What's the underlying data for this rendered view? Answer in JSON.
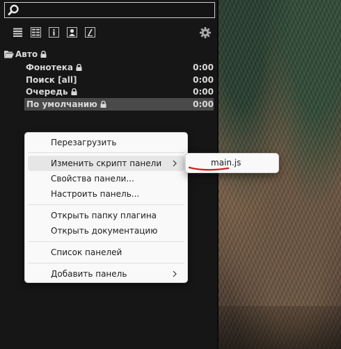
{
  "search": {
    "value": "",
    "placeholder": ""
  },
  "toolbar": {
    "buttons": [
      "list-view-icon",
      "grid-view-icon",
      "info-icon",
      "person-icon",
      "edit-icon"
    ],
    "settings_icon": "gear-icon"
  },
  "tree": {
    "root": {
      "label": "Авто",
      "icon": "folder-open-icon",
      "locked": true
    },
    "items": [
      {
        "label": "Фонотека",
        "time": "0:00",
        "locked": true,
        "selected": false
      },
      {
        "label": "Поиск [all]",
        "time": "0:00",
        "locked": false,
        "selected": false
      },
      {
        "label": "Очередь",
        "time": "0:00",
        "locked": true,
        "selected": false
      },
      {
        "label": "По умолчанию",
        "time": "0:00",
        "locked": true,
        "selected": true
      }
    ]
  },
  "context_menu": {
    "items": [
      {
        "label": "Перезагрузить"
      },
      {
        "label": "Изменить скрипт панели",
        "submenu": true,
        "highlighted": true
      },
      {
        "label": "Свойства панели..."
      },
      {
        "label": "Настроить панель..."
      },
      {
        "label": "Открыть папку плагина"
      },
      {
        "label": "Открыть документацию"
      },
      {
        "label": "Список панелей"
      },
      {
        "label": "Добавить панель",
        "submenu": true
      }
    ]
  },
  "submenu": {
    "items": [
      {
        "label": "main.js"
      }
    ]
  },
  "colors": {
    "panel_bg": "#161616",
    "text": "#d9d9d9",
    "selected_bg": "#4a4a4a",
    "menu_bg": "#f9f9f9",
    "menu_hover": "#e6e6e6",
    "annotation_red": "#d42020"
  }
}
